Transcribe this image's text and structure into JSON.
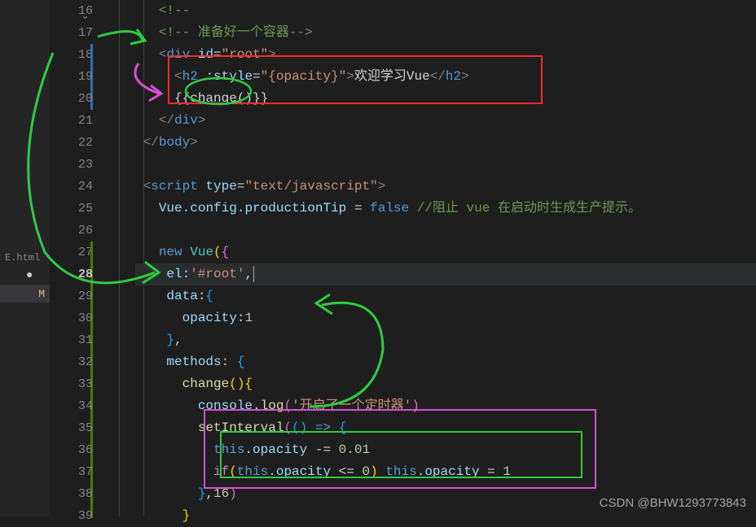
{
  "sidebar": {
    "file_label": "E.html",
    "modified_marker": "M"
  },
  "gutter": {
    "lines": [
      "16",
      "17",
      "18",
      "19",
      "20",
      "21",
      "22",
      "23",
      "24",
      "25",
      "26",
      "27",
      "28",
      "29",
      "30",
      "31",
      "32",
      "33",
      "34",
      "35",
      "36",
      "37",
      "38",
      "39"
    ],
    "current": "28"
  },
  "code": {
    "l16_comment_open": "<!--",
    "l17_comment": "<!-- 准备好一个容器-->",
    "l18": {
      "tag": "div",
      "attr": "id",
      "val": "\"root\""
    },
    "l19": {
      "tag": "h2",
      "attr": ":style",
      "val": "\"{opacity}\"",
      "text": "欢迎学习Vue"
    },
    "l20": "{{change()}}",
    "l21": {
      "tag": "div"
    },
    "l22": {
      "tag": "body"
    },
    "l24": {
      "tag": "script",
      "attr": "type",
      "val": "\"text/javascript\""
    },
    "l25": {
      "obj": "Vue",
      "p1": "config",
      "p2": "productionTip",
      "val": "false",
      "comment": "//阻止 vue 在启动时生成生产提示。"
    },
    "l27": {
      "kw": "new",
      "cls": "Vue"
    },
    "l28": {
      "prop": "el",
      "val": "'#root'"
    },
    "l29": {
      "prop": "data"
    },
    "l30": {
      "prop": "opacity",
      "val": "1"
    },
    "l32": {
      "prop": "methods"
    },
    "l33": {
      "fn": "change"
    },
    "l34": {
      "obj": "console",
      "fn": "log",
      "arg": "'开启了一个定时器'"
    },
    "l35": {
      "fn": "setInterval"
    },
    "l36": {
      "this": "this",
      "prop": "opacity",
      "op": "-=",
      "val": "0.01"
    },
    "l37": {
      "if": "if",
      "this": "this",
      "prop": "opacity",
      "cmp": "<=",
      "zero": "0",
      "this2": "this",
      "prop2": "opacity",
      "eq": "=",
      "one": "1"
    },
    "l38": {
      "num": "16"
    }
  },
  "watermark": "CSDN @BHW1293773843"
}
